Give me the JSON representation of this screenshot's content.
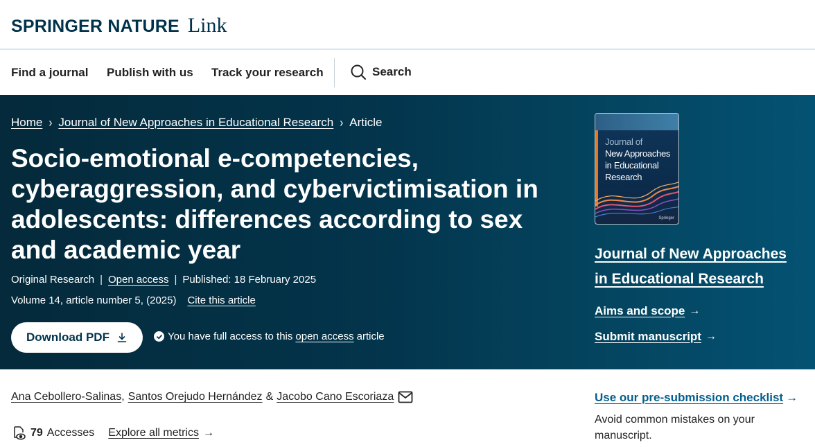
{
  "brand": {
    "name": "SPRINGER NATURE",
    "product": "Link"
  },
  "nav": {
    "find_journal": "Find a journal",
    "publish": "Publish with us",
    "track": "Track your research",
    "search": "Search"
  },
  "breadcrumb": {
    "home": "Home",
    "journal": "Journal of New Approaches in Educational Research",
    "current": "Article"
  },
  "article": {
    "title": "Socio-emotional e-competencies, cyberaggression, and cybervictimisation in adolescents: differences according to sex and academic year",
    "type": "Original Research",
    "open_access": "Open access",
    "published": "Published: 18 February 2025",
    "volume": "Volume 14, article number 5, (2025)",
    "cite": "Cite this article"
  },
  "download": {
    "label": "Download PDF"
  },
  "access_note": {
    "prefix": "You have full access to this",
    "link": "open access",
    "suffix": "article"
  },
  "cover": {
    "line0": "Journal of",
    "line1": "New Approaches",
    "line2": "in Educational",
    "line3": "Research",
    "publisher": "Springer"
  },
  "sidebar": {
    "journal_title": "Journal of New Approaches in Educational Research",
    "aims": "Aims and scope",
    "submit": "Submit manuscript",
    "checklist": "Use our pre-submission checklist",
    "checklist_desc": "Avoid common mistakes on your manuscript."
  },
  "authors": {
    "a1": "Ana Cebollero-Salinas",
    "a2": "Santos Orejudo Hernández",
    "a3": "Jacobo Cano Escoriaza",
    "sep1": ",",
    "sep2": "&"
  },
  "metrics": {
    "count": "79",
    "label": "Accesses",
    "explore": "Explore all metrics"
  },
  "icons": {
    "search": "search-icon",
    "download": "download-icon",
    "check": "check-circle-icon",
    "mail": "mail-icon",
    "accesses": "eye-document-icon",
    "arrow": "arrow-right-icon",
    "chevron": "chevron-right-icon"
  },
  "colors": {
    "brand": "#01324b",
    "hero": "#03344b",
    "link": "#025e8d"
  }
}
